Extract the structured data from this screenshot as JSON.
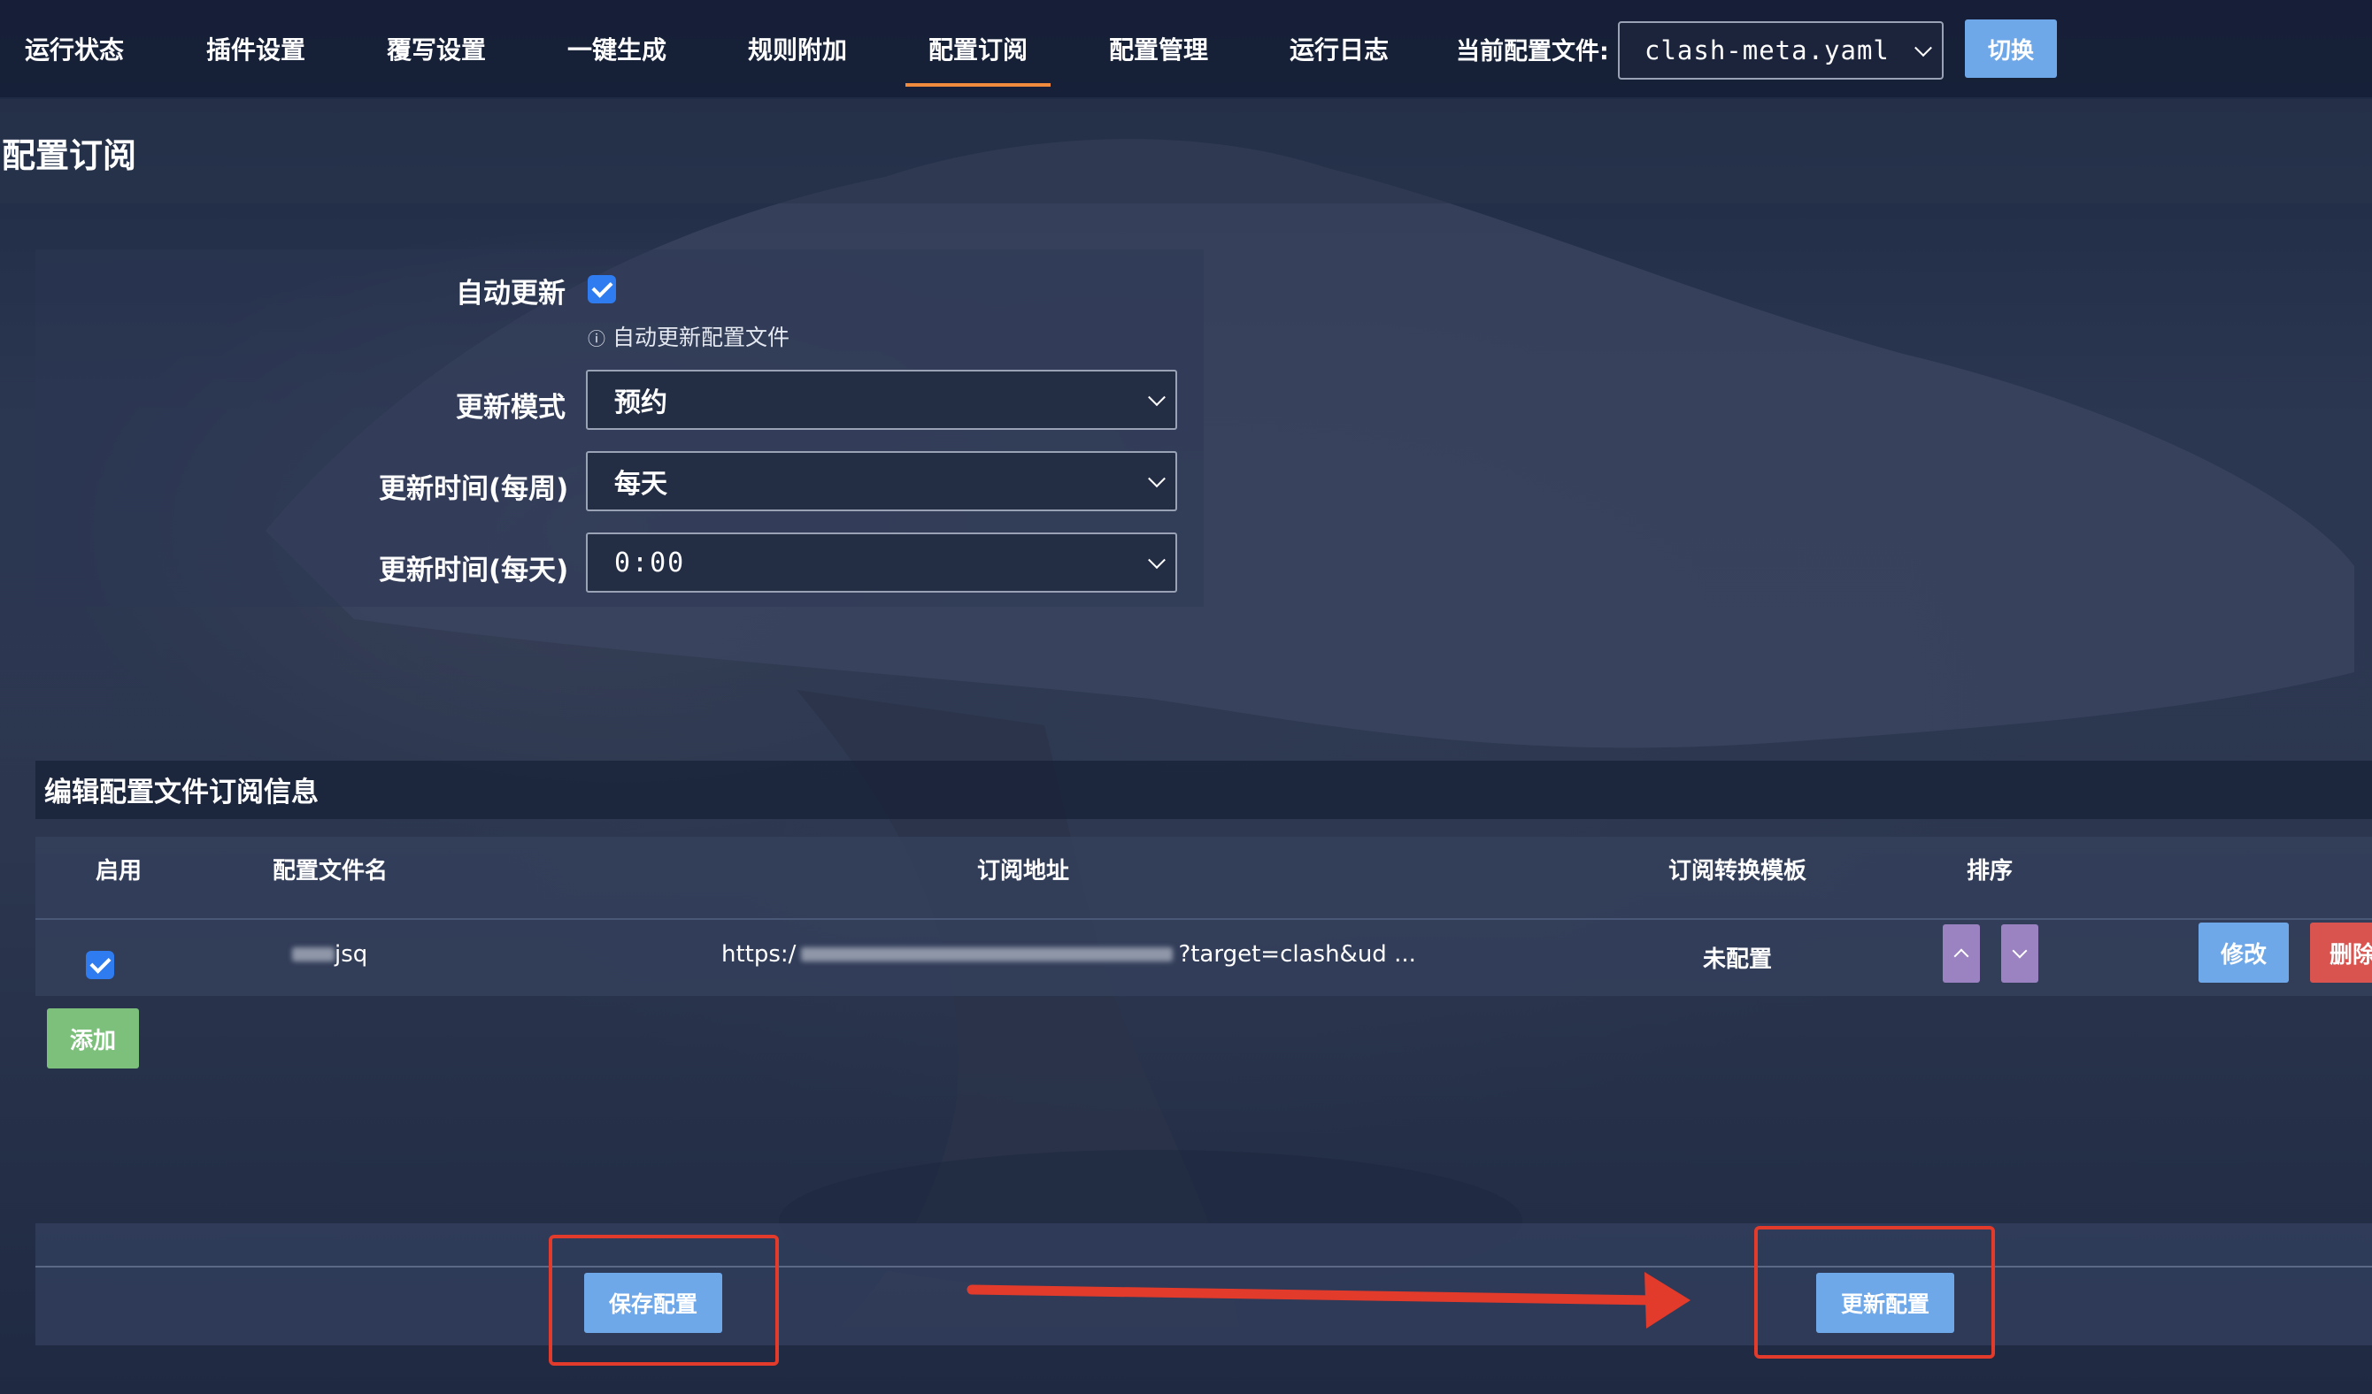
{
  "nav": {
    "tabs": [
      "运行状态",
      "插件设置",
      "覆写设置",
      "一键生成",
      "规则附加",
      "配置订阅",
      "配置管理",
      "运行日志"
    ],
    "active_tab": "配置订阅",
    "current_file_label": "当前配置文件:",
    "current_file_value": "clash-meta.yaml",
    "switch_label": "切换"
  },
  "page": {
    "title": "配置订阅"
  },
  "settings": {
    "auto_update_label": "自动更新",
    "auto_update_checked": true,
    "auto_update_hint": "自动更新配置文件",
    "mode_label": "更新模式",
    "mode_value": "预约",
    "weekly_label": "更新时间(每周)",
    "weekly_value": "每天",
    "daily_label": "更新时间(每天)",
    "daily_value": "0:00"
  },
  "subscriptions": {
    "title": "编辑配置文件订阅信息",
    "columns": [
      "启用",
      "配置文件名",
      "订阅地址",
      "订阅转换模板",
      "排序"
    ],
    "rows": [
      {
        "enabled": true,
        "name_visible": "jsq",
        "url_prefix": "https:/",
        "url_suffix": "?target=clash&ud ...",
        "template": "未配置",
        "edit_label": "修改",
        "delete_label": "删除"
      }
    ],
    "add_label": "添加"
  },
  "actions": {
    "save_label": "保存配置",
    "update_label": "更新配置"
  },
  "colors": {
    "primary_button": "#6fa8e8",
    "add_button": "#7cc07c",
    "delete_button": "#d9534f",
    "sort_button": "#9b82c0",
    "active_tab_underline": "#f08a3c",
    "annotation": "#e23a2b"
  }
}
